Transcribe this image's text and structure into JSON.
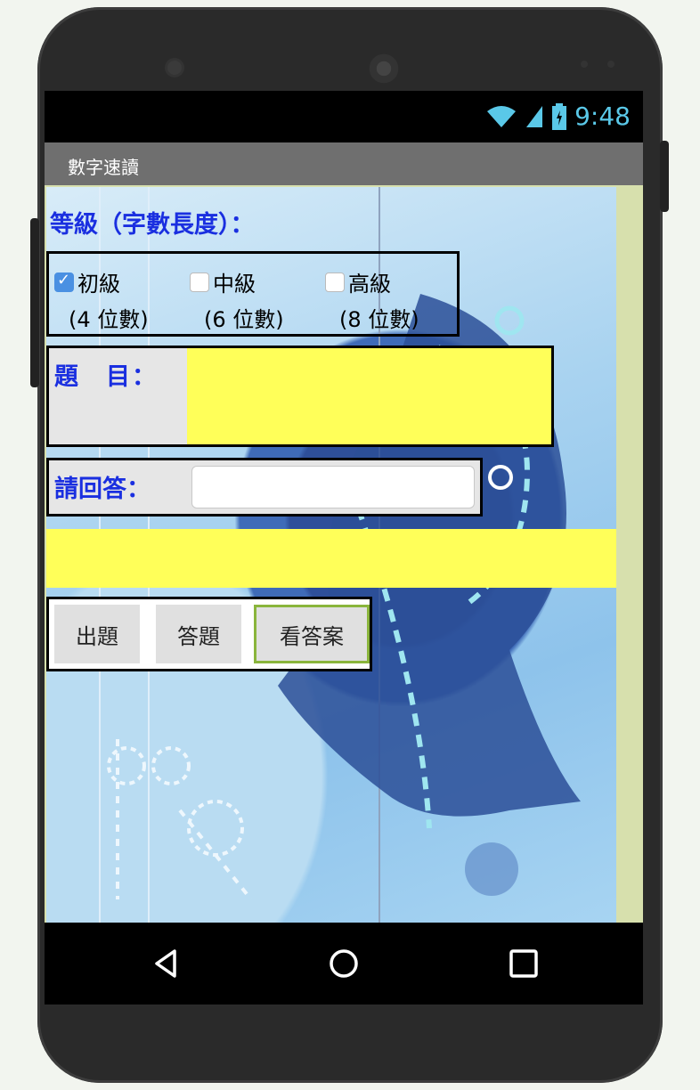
{
  "app": {
    "title": "數字速讀"
  },
  "status": {
    "time": "9:48"
  },
  "level": {
    "heading": "等級（字數長度）：",
    "options": [
      {
        "label": "初級",
        "sub": "(4 位數)",
        "checked": true
      },
      {
        "label": "中級",
        "sub": "(6 位數)",
        "checked": false
      },
      {
        "label": "高級",
        "sub": "(8 位數)",
        "checked": false
      }
    ]
  },
  "question": {
    "label": "題　目：",
    "value": ""
  },
  "answer": {
    "label": "請回答：",
    "value": "",
    "placeholder": ""
  },
  "result": {
    "value": ""
  },
  "buttons": {
    "generate": "出題",
    "submit": "答題",
    "show_answer": "看答案"
  },
  "colors": {
    "accent_label": "#1a2fe0",
    "highlight": "#ffff59",
    "status_icon": "#5ac8e8",
    "focus_border": "#8ab53c"
  },
  "icons": {
    "wifi": "wifi-icon",
    "signal": "signal-icon",
    "battery": "battery-icon",
    "back": "back-icon",
    "home": "home-icon",
    "recent": "recent-apps-icon"
  }
}
